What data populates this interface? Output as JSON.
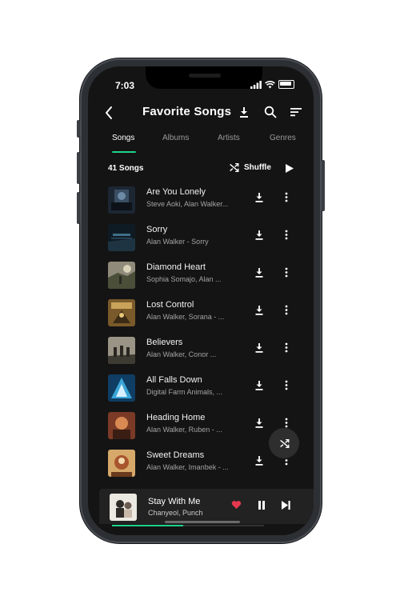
{
  "status": {
    "time": "7:03"
  },
  "header": {
    "title": "Favorite Songs"
  },
  "tabs": [
    {
      "label": "Songs",
      "active": true
    },
    {
      "label": "Albums",
      "active": false
    },
    {
      "label": "Artists",
      "active": false
    },
    {
      "label": "Genres",
      "active": false
    }
  ],
  "list": {
    "count": "41 Songs",
    "shuffle_label": "Shuffle",
    "songs": [
      {
        "title": "Are You Lonely",
        "artist": "Steve Aoki, Alan Walker..."
      },
      {
        "title": "Sorry",
        "artist": "Alan Walker - Sorry"
      },
      {
        "title": "Diamond Heart",
        "artist": "Sophia Somajo, Alan ..."
      },
      {
        "title": "Lost Control",
        "artist": "Alan Walker, Sorana - ..."
      },
      {
        "title": "Believers",
        "artist": "Alan Walker, Conor ..."
      },
      {
        "title": "All Falls Down",
        "artist": "Digital Farm Animals, ..."
      },
      {
        "title": "Heading Home",
        "artist": "Alan Walker, Ruben - ..."
      },
      {
        "title": "Sweet Dreams",
        "artist": "Alan Walker, Imanbek - ..."
      }
    ]
  },
  "now_playing": {
    "title": "Stay With Me",
    "artist": "Chanyeol, Punch",
    "progress": 0.47,
    "liked": true
  },
  "colors": {
    "accent": "#1ed28a",
    "heart": "#e5384f",
    "background": "#141414"
  }
}
